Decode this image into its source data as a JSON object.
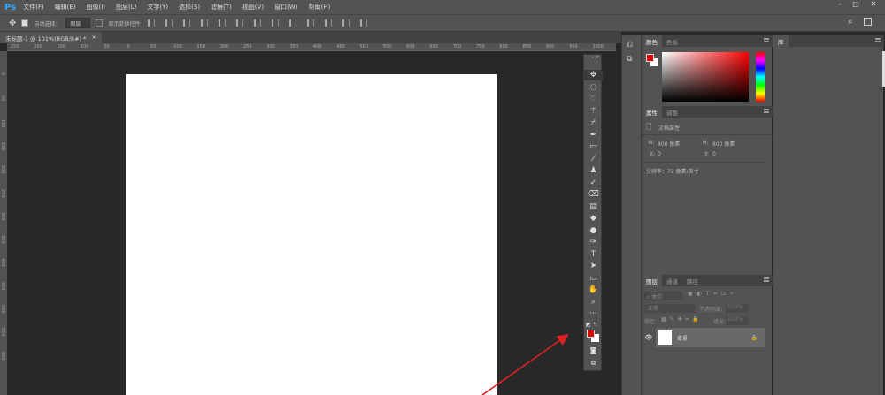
{
  "app": {
    "logo": "Ps",
    "menu": [
      "文件(F)",
      "编辑(E)",
      "图像(I)",
      "图层(L)",
      "文字(Y)",
      "选择(S)",
      "滤镜(T)",
      "视图(V)",
      "窗口(W)",
      "帮助(H)"
    ],
    "window_controls": [
      "–",
      "□",
      "✕"
    ]
  },
  "options": {
    "auto_select_label": "自动选择：",
    "auto_select_value": "图层",
    "show_transform_label": "显示变换控件"
  },
  "document_tab": {
    "title": "未标题-1 @ 101%(RGB/8#) *",
    "close": "×"
  },
  "ruler": {
    "h_labels": [
      "250",
      "200",
      "150",
      "100",
      "50",
      "0",
      "50",
      "100",
      "150",
      "200",
      "250",
      "300",
      "350",
      "400",
      "450",
      "500",
      "550",
      "600",
      "650",
      "700",
      "750",
      "800",
      "850",
      "900",
      "950",
      "1000"
    ],
    "v_labels": [
      "0",
      "50",
      "100",
      "150",
      "200",
      "250",
      "300",
      "350",
      "400",
      "450",
      "500",
      "550",
      "600"
    ]
  },
  "tools": [
    "move",
    "marquee",
    "lasso",
    "magic-wand",
    "crop",
    "eyedropper",
    "healing",
    "brush",
    "stamp",
    "history-brush",
    "eraser",
    "gradient",
    "blur",
    "dodge",
    "pen",
    "type",
    "path-select",
    "rectangle",
    "hand",
    "zoom",
    "more"
  ],
  "colors": {
    "foreground": "#e00000",
    "background": "#ffffff"
  },
  "color_panel": {
    "tabs": [
      "颜色",
      "色板"
    ]
  },
  "properties_panel": {
    "tabs": [
      "属性",
      "调整"
    ],
    "title": "文档属性",
    "w_label": "W:",
    "w_value": "800 像素",
    "h_label": "H:",
    "h_value": "800 像素",
    "x_label": "X:",
    "x_value": "0",
    "y_label": "Y:",
    "y_value": "0",
    "resolution": "分辨率：72 像素/英寸"
  },
  "layers_panel": {
    "tabs": [
      "图层",
      "通道",
      "路径"
    ],
    "filter": "类型",
    "blend": "正常",
    "opacity_label": "不透明度：",
    "opacity": "100%",
    "lock_label": "锁定：",
    "fill_label": "填充：",
    "fill": "100%",
    "layers": [
      {
        "name": "背景",
        "visible": true,
        "locked": true
      }
    ]
  },
  "library_panel": {
    "tab": "库"
  }
}
